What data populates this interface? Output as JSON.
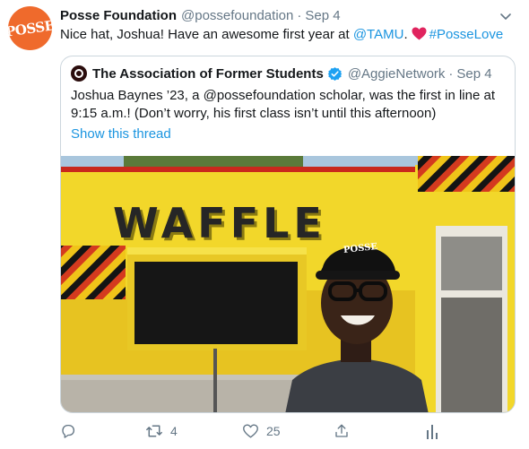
{
  "tweet": {
    "avatar_text": "POSSE",
    "author_name": "Posse Foundation",
    "author_handle": "@possefoundation",
    "separator": "·",
    "date": "Sep 4",
    "text_before": "Nice hat, Joshua! Have an awesome first year at ",
    "mention": "@TAMU",
    "text_after": ".",
    "hashtag": "#PosseLove",
    "link_color": "#1b95e0",
    "heart_color": "#e0245e",
    "more_icon": "chevron-down-icon"
  },
  "quoted_tweet": {
    "author_name": "The Association of Former Students",
    "author_handle": "@AggieNetwork",
    "separator": "·",
    "date": "Sep 4",
    "text_line1": "Joshua Baynes ’23, a @possefoundation scholar, was the first in line at",
    "text_line2": "9:15 a.m.! (Don’t worry, his first class isn’t until this afternoon)",
    "show_thread": "Show this thread",
    "photo_sign_text": "WAFFLE",
    "photo_hat_text": "POSSE"
  },
  "actions": {
    "reply_icon": "reply-icon",
    "retweet_icon": "retweet-icon",
    "retweet_count": "4",
    "like_icon": "heart-outline-icon",
    "like_count": "25",
    "share_icon": "share-icon",
    "analytics_icon": "analytics-icon"
  }
}
